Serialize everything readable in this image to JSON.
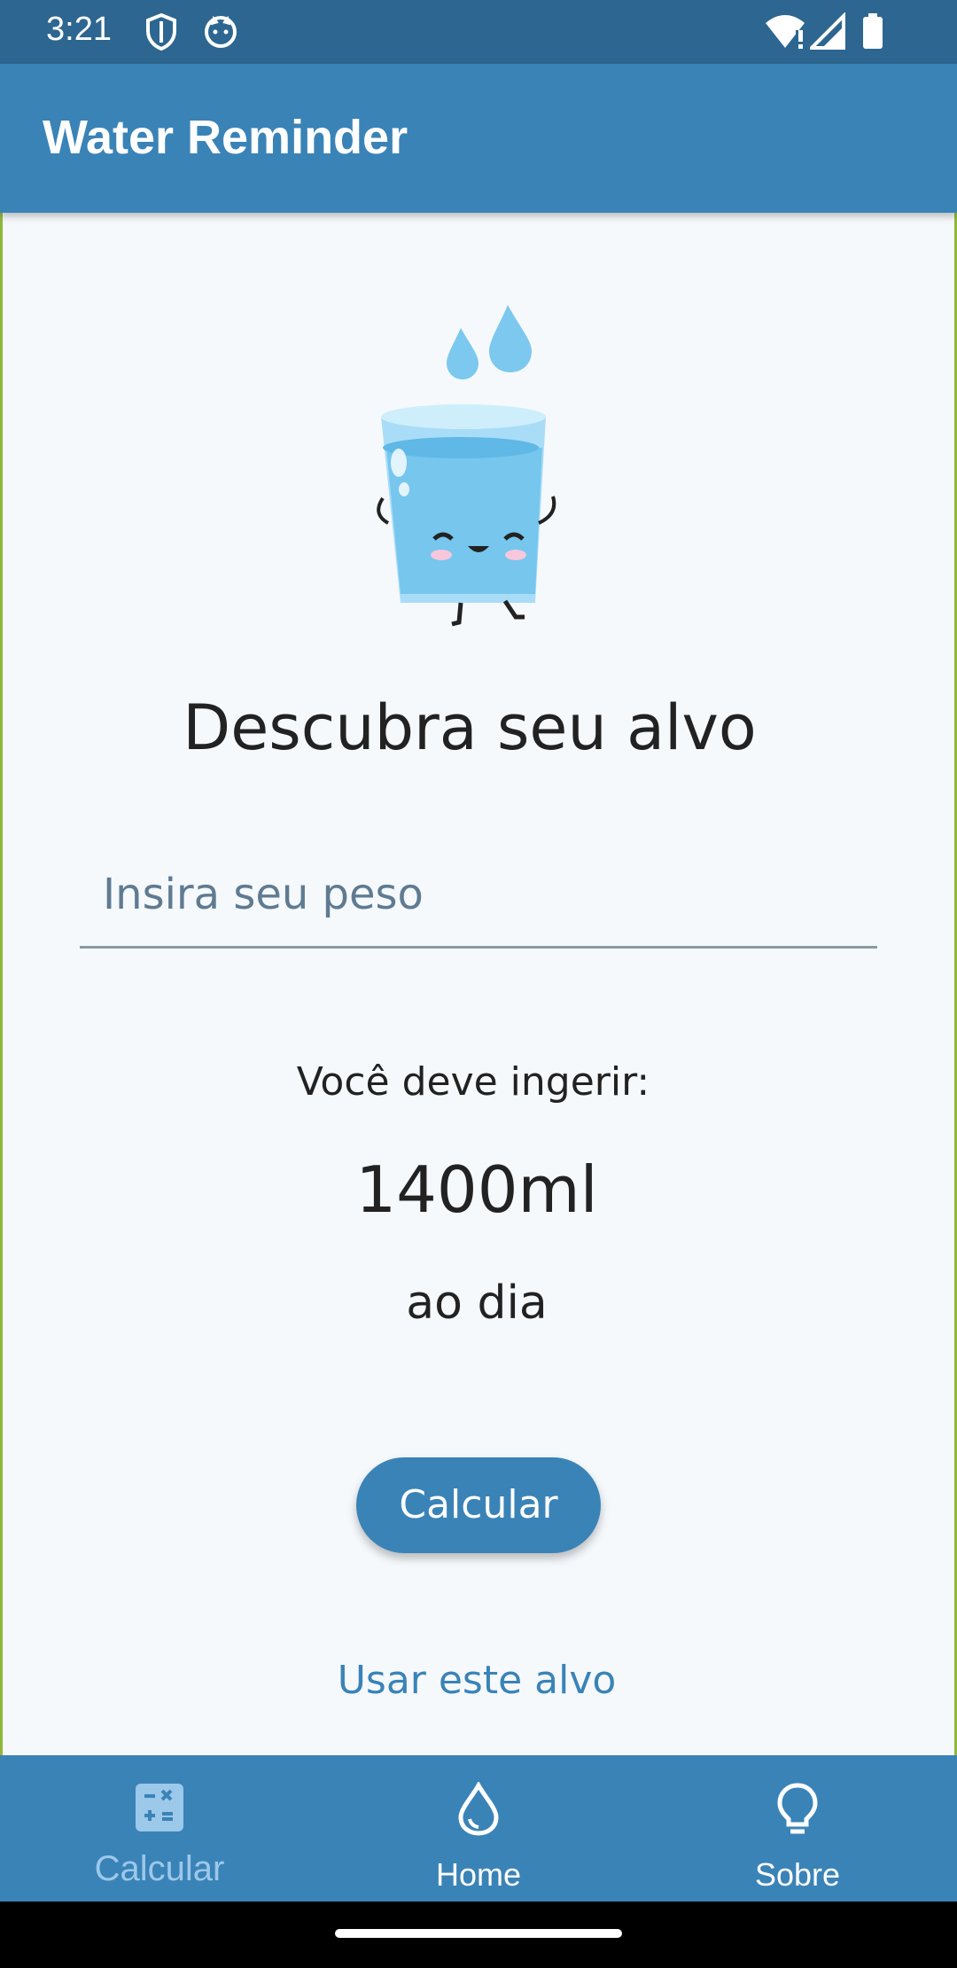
{
  "status_bar": {
    "time": "3:21",
    "icons": [
      "shield-icon",
      "cat-face-icon",
      "wifi-alert-icon",
      "cellular-icon",
      "battery-icon"
    ]
  },
  "app_bar": {
    "title": "Water Reminder"
  },
  "main": {
    "headline": "Descubra seu alvo",
    "weight_input": {
      "placeholder": "Insira seu peso",
      "value": ""
    },
    "result_label": "Você deve ingerir:",
    "result_amount": "1400ml",
    "result_suffix": "ao dia",
    "calculate_button": "Calcular",
    "use_target_link": "Usar este alvo"
  },
  "bottom_nav": {
    "items": [
      {
        "label": "Calcular",
        "icon": "calculator-icon",
        "active": false
      },
      {
        "label": "Home",
        "icon": "water-drop-icon",
        "active": true
      },
      {
        "label": "Sobre",
        "icon": "lightbulb-icon",
        "active": true
      }
    ]
  },
  "colors": {
    "primary": "#3a83b7",
    "status_bar": "#2d6690",
    "background": "#f5f9fc",
    "inactive_nav": "#9cc8ea"
  }
}
